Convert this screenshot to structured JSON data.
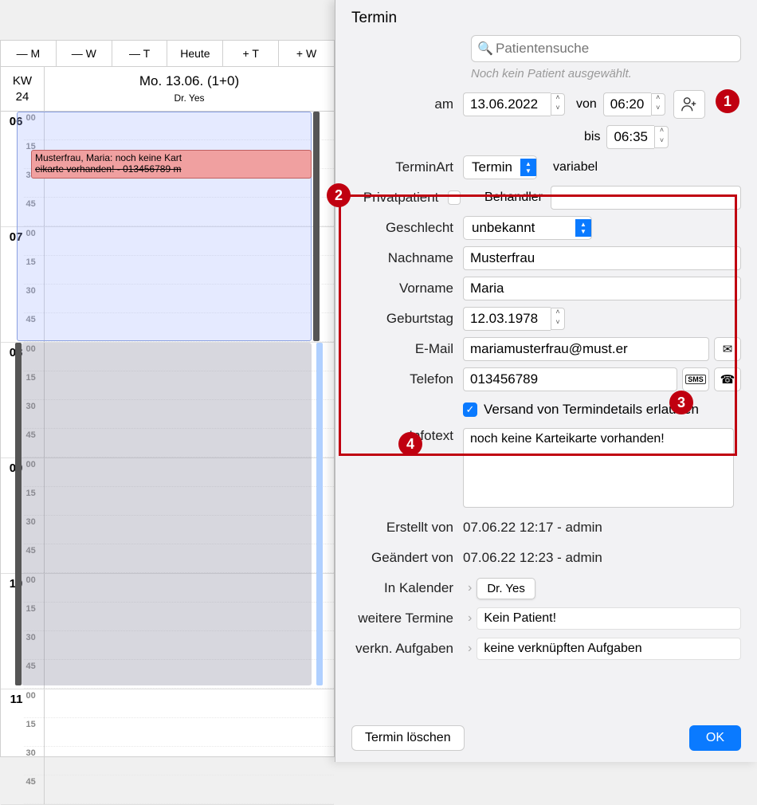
{
  "calendar": {
    "toolbar": [
      "— M",
      "— W",
      "— T",
      "Heute",
      "+ T",
      "+ W"
    ],
    "kw_label": "KW",
    "kw_num": "24",
    "day_title": "Mo. 13.06. (1+0)",
    "doctor": "Dr. Yes",
    "hours": [
      "06",
      "07",
      "08",
      "09",
      "10",
      "11"
    ],
    "minutes": [
      "00",
      "15",
      "30",
      "45"
    ],
    "appt_text": "Musterfrau, Maria: noch keine Kart",
    "appt_text2": "eikarte vorhanden! - 013456789  m"
  },
  "dialog": {
    "title": "Termin",
    "search_placeholder": "Patientensuche",
    "no_patient_hint": "Noch kein Patient ausgewählt.",
    "labels": {
      "am": "am",
      "von": "von",
      "bis": "bis",
      "terminart": "TerminArt",
      "variabel": "variabel",
      "privat": "Privatpatient",
      "behandler": "Behandler",
      "geschlecht": "Geschlecht",
      "nachname": "Nachname",
      "vorname": "Vorname",
      "geburtstag": "Geburtstag",
      "email": "E-Mail",
      "telefon": "Telefon",
      "versand": "Versand von Termindetails erlauben",
      "infotext": "Infotext",
      "erstellt": "Erstellt von",
      "geaendert": "Geändert von",
      "inkalender": "In Kalender",
      "weitere": "weitere Termine",
      "verkn": "verkn. Aufgaben"
    },
    "values": {
      "date": "13.06.2022",
      "von": "06:20",
      "bis": "06:35",
      "terminart": "Termin",
      "geschlecht": "unbekannt",
      "nachname": "Musterfrau",
      "vorname": "Maria",
      "geburtstag": "12.03.1978",
      "email": "mariamusterfrau@must.er",
      "telefon": "013456789",
      "infotext": "noch keine Karteikarte vorhanden!",
      "erstellt": "07.06.22 12:17  -  admin",
      "geaendert": "07.06.22 12:23  -  admin",
      "inkalender": "Dr. Yes",
      "weitere": "Kein Patient!",
      "verkn": "keine verknüpften Aufgaben"
    },
    "buttons": {
      "delete": "Termin löschen",
      "ok": "OK"
    }
  },
  "annotations": [
    "1",
    "2",
    "3",
    "4"
  ]
}
